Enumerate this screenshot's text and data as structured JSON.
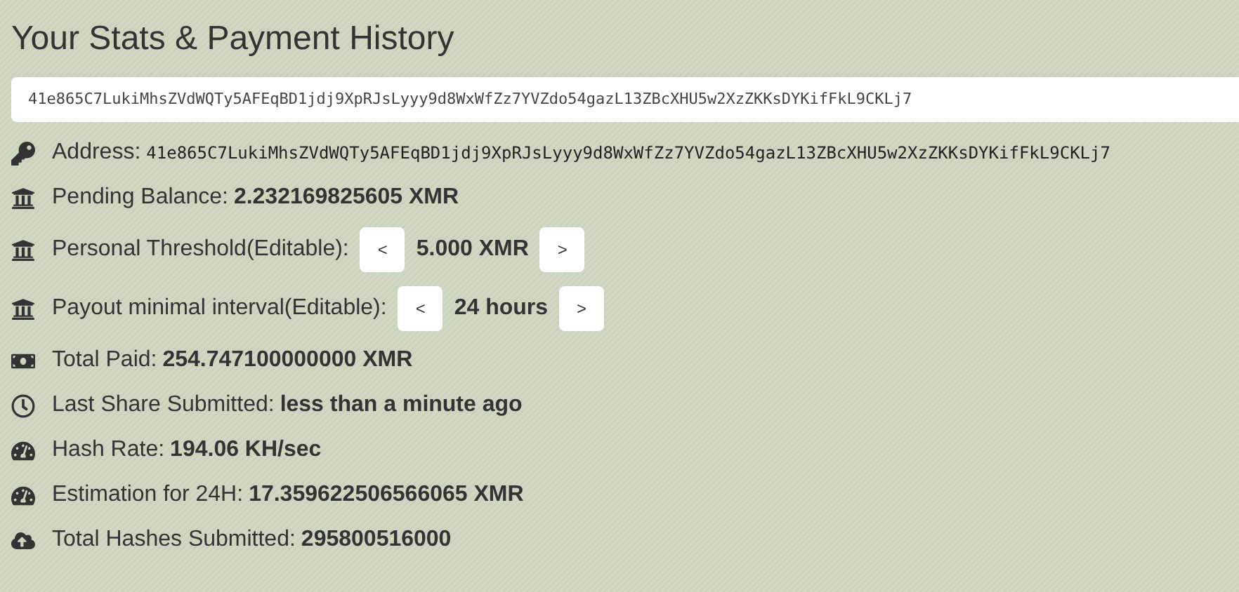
{
  "title": "Your Stats & Payment History",
  "address_field": {
    "value": "41e865C7LukiMhsZVdWQTy5AFEqBD1jdj9XpRJsLyyy9d8WxWfZz7YVZdo54gazL13ZBcXHU5w2XzZKKsDYKifFkL9CKLj7"
  },
  "rows": [
    {
      "kind": "address",
      "label": "Address:",
      "value": "41e865C7LukiMhsZVdWQTy5AFEqBD1jdj9XpRJsLyyy9d8WxWfZz7YVZdo54gazL13ZBcXHU5w2XzZKKsDYKifFkL9CKLj7"
    },
    {
      "kind": "stat",
      "label": "Pending Balance:",
      "value": "2.232169825605 XMR"
    },
    {
      "kind": "stepper",
      "label": "Personal Threshold(Editable):",
      "prev": "<",
      "value": "5.000 XMR",
      "next": ">"
    },
    {
      "kind": "stepper",
      "label": "Payout minimal interval(Editable):",
      "prev": "<",
      "value": "24 hours",
      "next": ">"
    },
    {
      "kind": "stat",
      "label": "Total Paid:",
      "value": "254.747100000000 XMR"
    },
    {
      "kind": "stat",
      "label": "Last Share Submitted:",
      "value": "less than a minute ago"
    },
    {
      "kind": "stat",
      "label": "Hash Rate:",
      "value": "194.06 KH/sec"
    },
    {
      "kind": "stat",
      "label": "Estimation for 24H:",
      "value": "17.359622506566065 XMR"
    },
    {
      "kind": "stat",
      "label": "Total Hashes Submitted:",
      "value": "295800516000"
    }
  ]
}
